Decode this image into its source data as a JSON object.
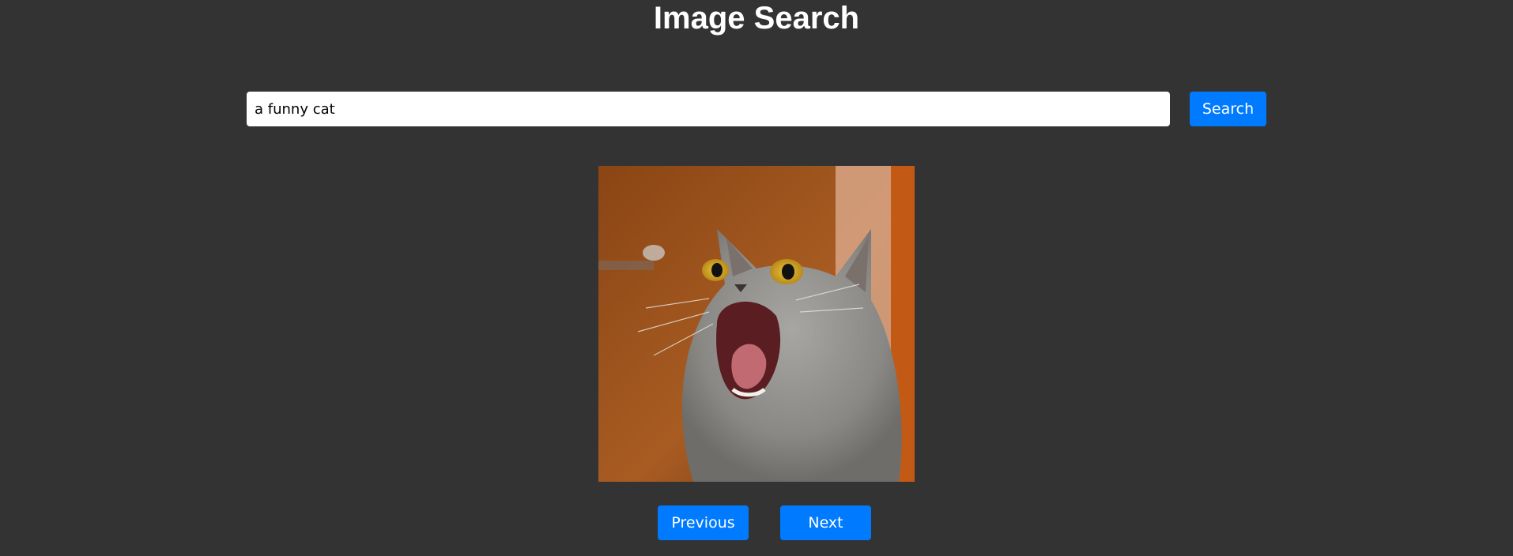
{
  "header": {
    "title": "Image Search"
  },
  "search": {
    "query": "a funny cat",
    "button_label": "Search"
  },
  "result": {
    "icon": "cat-photo"
  },
  "pagination": {
    "previous_label": "Previous",
    "next_label": "Next"
  },
  "colors": {
    "background": "#333333",
    "accent": "#007bff",
    "title": "#ffffff"
  }
}
